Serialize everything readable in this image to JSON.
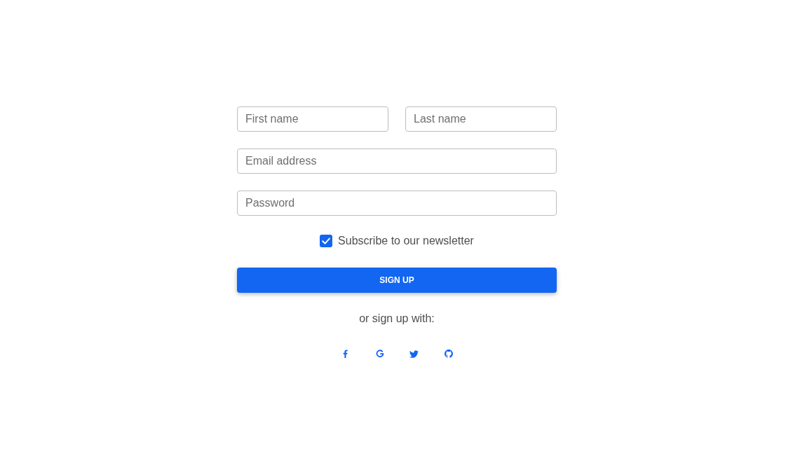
{
  "form": {
    "first_name": {
      "placeholder": "First name"
    },
    "last_name": {
      "placeholder": "Last name"
    },
    "email": {
      "placeholder": "Email address"
    },
    "password": {
      "placeholder": "Password"
    },
    "newsletter": {
      "label": "Subscribe to our newsletter",
      "checked": true
    },
    "submit_button": "SIGN UP",
    "social_prompt": "or sign up with:"
  }
}
